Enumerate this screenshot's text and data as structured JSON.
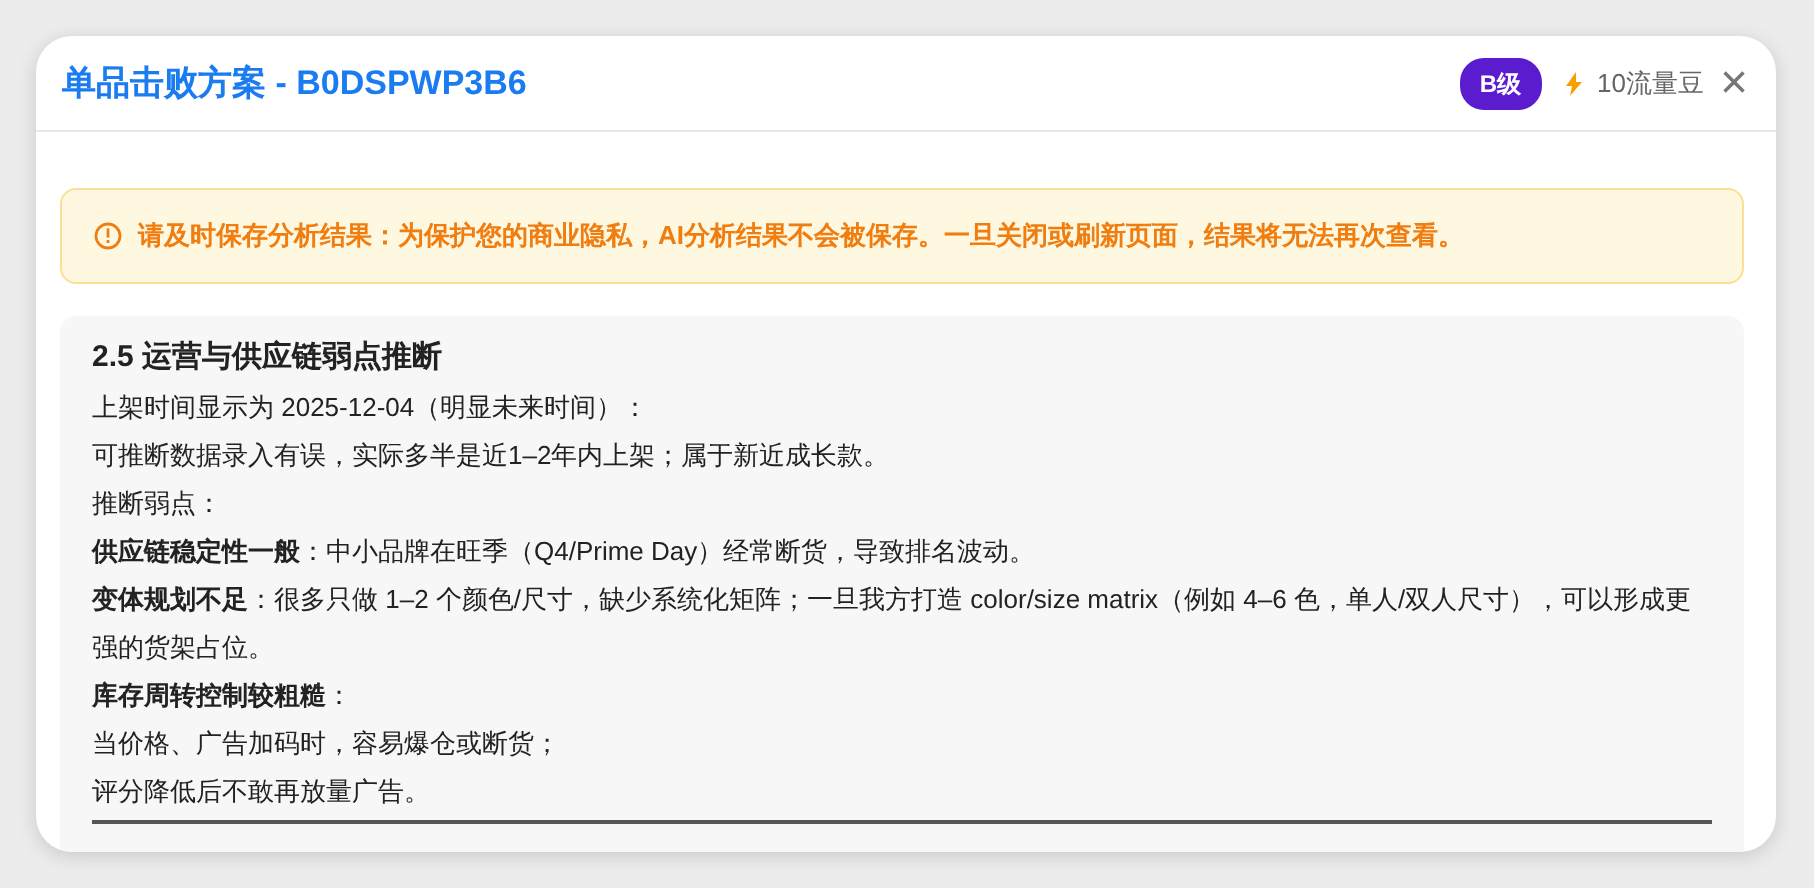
{
  "dialog": {
    "title": "单品击败方案 - B0DSPWP3B6",
    "grade_badge": "B级",
    "cost": "10流量豆",
    "close": "×"
  },
  "alert": {
    "text": "请及时保存分析结果：为保护您的商业隐私，AI分析结果不会被保存。一旦关闭或刷新页面，结果将无法再次查看。"
  },
  "section": {
    "heading": "2.5 运营与供应链弱点推断",
    "lines": [
      "上架时间显示为 2025-12-04（明显未来时间）：",
      "可推断数据录入有误，实际多半是近1–2年内上架；属于新近成长款。",
      "推断弱点：",
      "**供应链稳定性一般**：中小品牌在旺季（Q4/Prime Day）经常断货，导致排名波动。",
      "**变体规划不足**：很多只做 1–2 个颜色/尺寸，缺少系统化矩阵；一旦我方打造 color/size matrix（例如 4–6 色，单人/双人尺寸），可以形成更强的货架占位。",
      "**库存周转控制较粗糙**：",
      "当价格、广告加码时，容易爆仓或断货；",
      "评分降低后不敢再放量广告。"
    ]
  }
}
